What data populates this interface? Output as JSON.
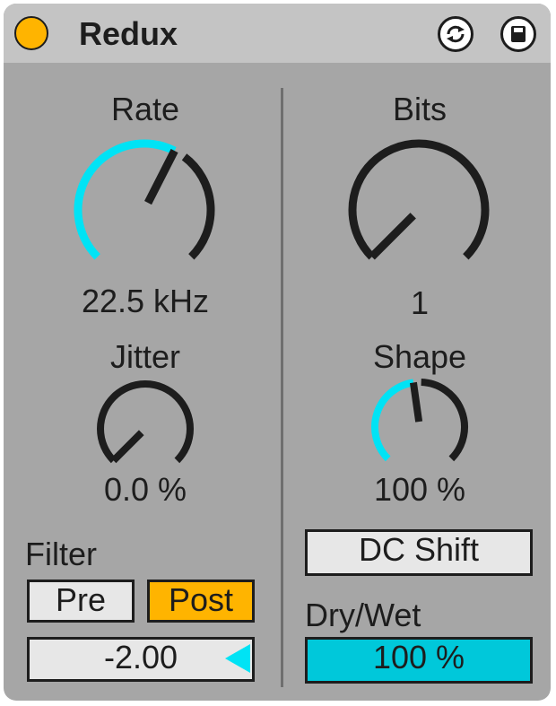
{
  "device": {
    "title": "Redux",
    "colors": {
      "accent": "#00e3f5",
      "active": "#ffb400",
      "body": "#a6a6a6",
      "header": "#c4c4c4",
      "dark": "#1d1d1d"
    },
    "header_icons": [
      "hot-swap-icon",
      "save-preset-icon"
    ]
  },
  "left": {
    "rate": {
      "label": "Rate",
      "value": "22.5 kHz",
      "level": 0.6
    },
    "jitter": {
      "label": "Jitter",
      "value": "0.0 %",
      "level": 0.0
    },
    "filter": {
      "label": "Filter",
      "pre_label": "Pre",
      "post_label": "Post",
      "selected": "Post",
      "octaves_value": "-2.00"
    }
  },
  "right": {
    "bits": {
      "label": "Bits",
      "value": "1",
      "level": 0.0
    },
    "shape": {
      "label": "Shape",
      "value": "100 %",
      "level": 0.47
    },
    "dc_shift_label": "DC Shift",
    "drywet": {
      "label": "Dry/Wet",
      "value": "100 %",
      "level": 1.0
    }
  }
}
